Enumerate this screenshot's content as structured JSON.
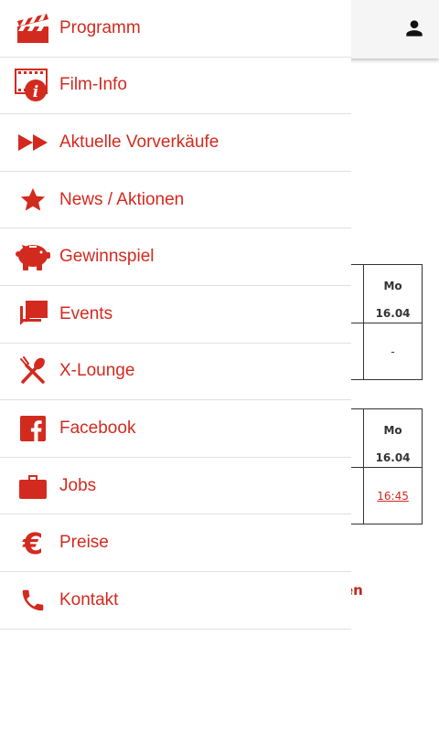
{
  "header": {
    "user_icon": "person-icon"
  },
  "nav": {
    "accent_color": "#d32a1f",
    "items": [
      {
        "label": "Programm",
        "icon": "clapperboard-icon"
      },
      {
        "label": "Film-Info",
        "icon": "film-info-icon"
      },
      {
        "label": "Aktuelle Vorverkäufe",
        "icon": "fast-forward-icon"
      },
      {
        "label": "News / Aktionen",
        "icon": "star-icon"
      },
      {
        "label": "Gewinnspiel",
        "icon": "piggy-bank-icon"
      },
      {
        "label": "Events",
        "icon": "chat-bubbles-icon"
      },
      {
        "label": "X-Lounge",
        "icon": "cutlery-icon"
      },
      {
        "label": "Facebook",
        "icon": "facebook-icon"
      },
      {
        "label": "Jobs",
        "icon": "briefcase-icon"
      },
      {
        "label": "Preise",
        "icon": "euro-icon"
      },
      {
        "label": "Kontakt",
        "icon": "phone-icon"
      }
    ]
  },
  "schedule": [
    {
      "day": "Mo",
      "date": "16.04",
      "value": "-"
    },
    {
      "day": "Mo",
      "date": "16.04",
      "value": "16:45"
    }
  ],
  "partial_text": "en"
}
